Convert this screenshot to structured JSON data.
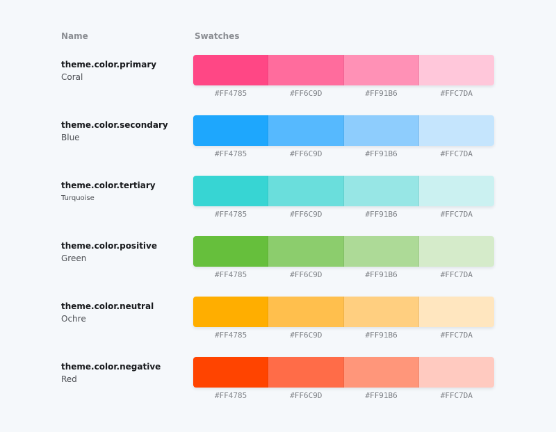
{
  "headers": {
    "name": "Name",
    "swatches": "Swatches"
  },
  "rows": [
    {
      "token": "theme.color.primary",
      "label": "Coral",
      "swatch_colors": [
        "#FF4785",
        "#FF6C9D",
        "#FF91B6",
        "#FFC7DA"
      ],
      "hex_labels": [
        "#FF4785",
        "#FF6C9D",
        "#FF91B6",
        "#FFC7DA"
      ]
    },
    {
      "token": "theme.color.secondary",
      "label": "Blue",
      "swatch_colors": [
        "#1EA7FD",
        "#56B9FE",
        "#8ECDFD",
        "#C5E5FD"
      ],
      "hex_labels": [
        "#FF4785",
        "#FF6C9D",
        "#FF91B6",
        "#FFC7DA"
      ]
    },
    {
      "token": "theme.color.tertiary",
      "label": "Turquoise",
      "swatch_colors": [
        "#37D5D3",
        "#6ADEDC",
        "#97E6E5",
        "#CBF1F1"
      ],
      "hex_labels": [
        "#FF4785",
        "#FF6C9D",
        "#FF91B6",
        "#FFC7DA"
      ]
    },
    {
      "token": "theme.color.positive",
      "label": "Green",
      "swatch_colors": [
        "#66BF3C",
        "#8CCD6D",
        "#ADDA97",
        "#D5EBCA"
      ],
      "hex_labels": [
        "#FF4785",
        "#FF6C9D",
        "#FF91B6",
        "#FFC7DA"
      ]
    },
    {
      "token": "theme.color.neutral",
      "label": "Ochre",
      "swatch_colors": [
        "#FFAE00",
        "#FFBF4D",
        "#FFCF80",
        "#FFE6BF"
      ],
      "hex_labels": [
        "#FF4785",
        "#FF6C9D",
        "#FF91B6",
        "#FFC7DA"
      ]
    },
    {
      "token": "theme.color.negative",
      "label": "Red",
      "swatch_colors": [
        "#FF4400",
        "#FF6C48",
        "#FF967A",
        "#FFCAC0"
      ],
      "hex_labels": [
        "#FF4785",
        "#FF6C9D",
        "#FF91B6",
        "#FFC7DA"
      ]
    }
  ]
}
